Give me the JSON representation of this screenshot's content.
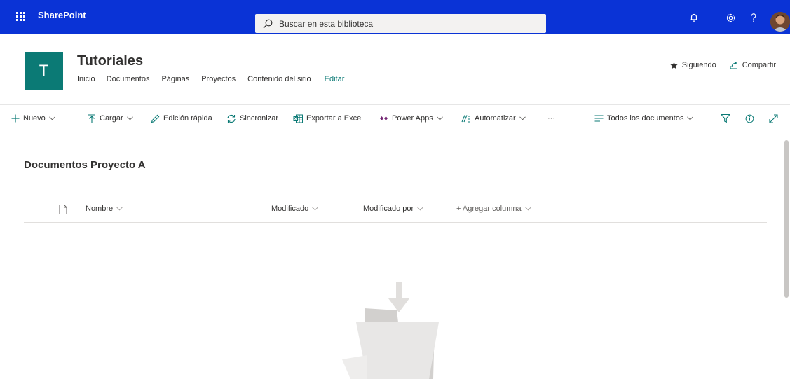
{
  "suite_bar": {
    "brand": "SharePoint",
    "search_placeholder": "Buscar en esta biblioteca",
    "icons": [
      "app-launcher-icon",
      "search-icon",
      "bell-icon",
      "gear-icon",
      "help-icon"
    ],
    "accent_color": "#0a33d6"
  },
  "site": {
    "logo_letter": "T",
    "logo_color": "#0b7a75",
    "title": "Tutoriales",
    "nav": [
      "Inicio",
      "Documentos",
      "Páginas",
      "Proyectos",
      "Contenido del sitio",
      "Editar"
    ],
    "follow_label": "Siguiendo",
    "share_label": "Compartir"
  },
  "command_bar": {
    "new_label": "Nuevo",
    "upload_label": "Cargar",
    "quick_edit_label": "Edición rápida",
    "sync_label": "Sincronizar",
    "export_label": "Exportar a Excel",
    "power_apps_label": "Power Apps",
    "automate_label": "Automatizar",
    "more_label": "···",
    "view_label": "Todos los documentos"
  },
  "library": {
    "title": "Documentos Proyecto A",
    "columns": {
      "name": "Nombre",
      "modified": "Modificado",
      "modified_by": "Modificado por",
      "add_column": "+ Agregar columna"
    }
  }
}
